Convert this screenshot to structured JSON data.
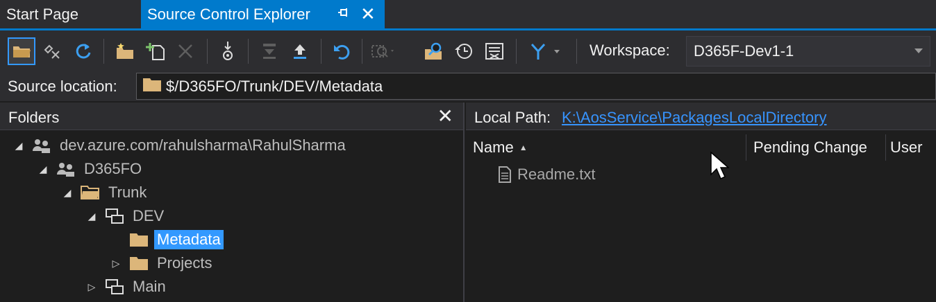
{
  "tabs": [
    {
      "label": "Start Page"
    },
    {
      "label": "Source Control Explorer"
    }
  ],
  "toolbar": {
    "buttons": [
      "open-folder-icon",
      "disconnect-icon",
      "refresh-icon",
      "new-folder-icon",
      "add-items-icon",
      "delete-icon",
      "rename-icon",
      "download-icon",
      "upload-icon",
      "undo-icon",
      "find-icon",
      "compare-icon",
      "history-icon",
      "view-shelvesets-icon",
      "branch-icon"
    ],
    "workspace_label": "Workspace:",
    "workspace_value": "D365F-Dev1-1"
  },
  "source_location": {
    "label": "Source location:",
    "value": "$/D365FO/Trunk/DEV/Metadata"
  },
  "folders": {
    "title": "Folders",
    "close": "✕",
    "tree": [
      {
        "label": "dev.azure.com/rahulsharma\\RahulSharma"
      },
      {
        "label": "D365FO"
      },
      {
        "label": "Trunk"
      },
      {
        "label": "DEV"
      },
      {
        "label": "Metadata"
      },
      {
        "label": "Projects"
      },
      {
        "label": "Main"
      }
    ]
  },
  "details": {
    "local_path_label": "Local Path:",
    "local_path_value": "K:\\AosService\\PackagesLocalDirectory",
    "columns": [
      "Name",
      "Pending Change",
      "User"
    ],
    "files": [
      {
        "name": "Readme.txt"
      }
    ]
  },
  "colors": {
    "accent": "#007acc",
    "selection": "#3399ff",
    "folder": "#dcb67a",
    "link": "#3794ff"
  }
}
